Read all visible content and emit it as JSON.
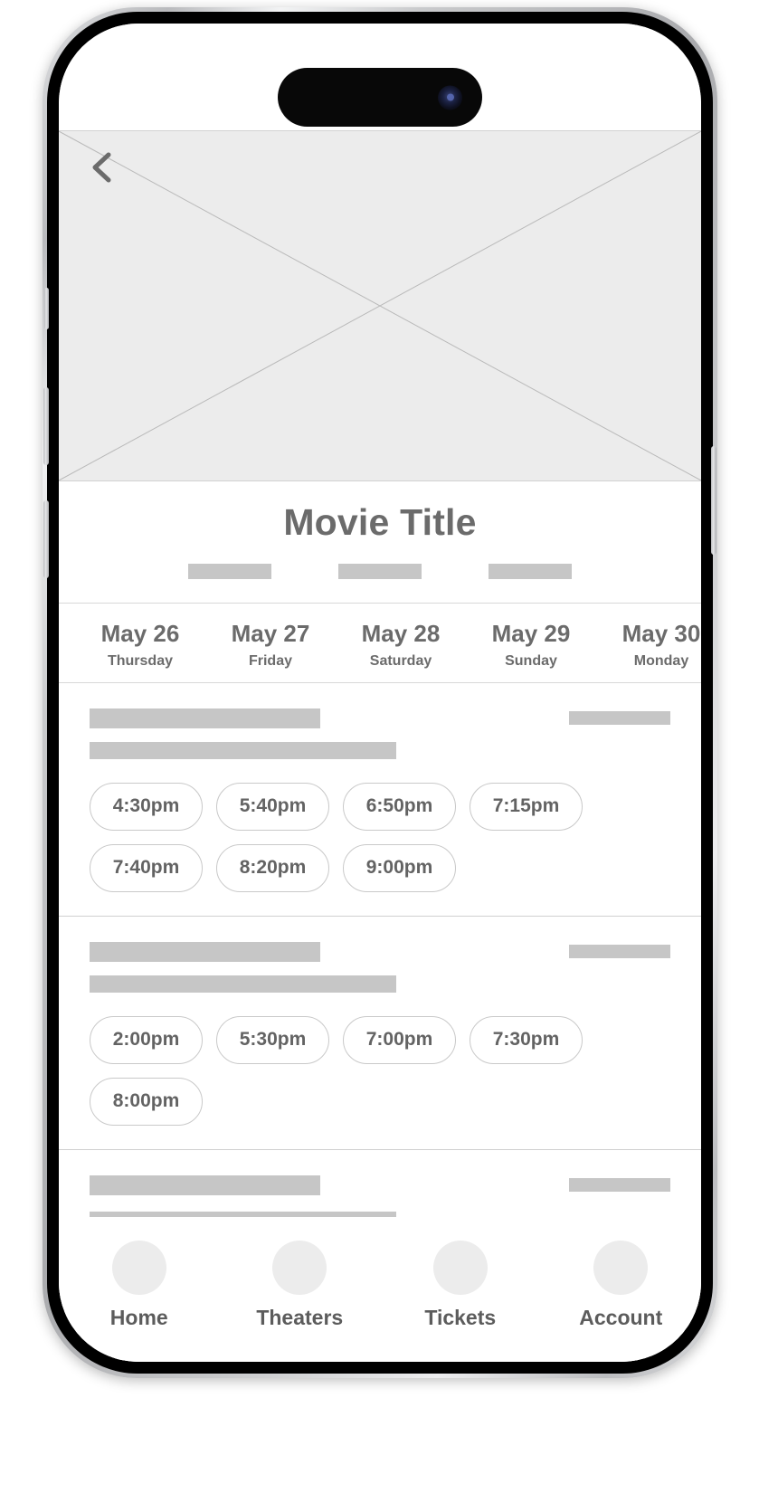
{
  "device": {
    "frame": "iphone-pro",
    "island_label": "dynamic-island",
    "camera_label": "front-camera"
  },
  "screen": {
    "hero": {
      "type": "image-placeholder",
      "back_icon": "chevron-left-icon"
    },
    "title": "Movie Title",
    "meta_placeholders": 3,
    "dates": [
      {
        "day": "May 26",
        "weekday": "Thursday"
      },
      {
        "day": "May 27",
        "weekday": "Friday"
      },
      {
        "day": "May 28",
        "weekday": "Saturday"
      },
      {
        "day": "May 29",
        "weekday": "Sunday"
      },
      {
        "day": "May 30",
        "weekday": "Monday"
      }
    ],
    "theaters": [
      {
        "name_placeholder": true,
        "distance_placeholder": true,
        "address_placeholder": true,
        "showtimes": [
          "4:30pm",
          "5:40pm",
          "6:50pm",
          "7:15pm",
          "7:40pm",
          "8:20pm",
          "9:00pm"
        ]
      },
      {
        "name_placeholder": true,
        "distance_placeholder": true,
        "address_placeholder": true,
        "showtimes": [
          "2:00pm",
          "5:30pm",
          "7:00pm",
          "7:30pm",
          "8:00pm"
        ]
      },
      {
        "name_placeholder": true,
        "distance_placeholder": true,
        "address_placeholder": true,
        "showtimes": []
      }
    ],
    "tabs": [
      {
        "label": "Home",
        "icon": "home-icon"
      },
      {
        "label": "Theaters",
        "icon": "theaters-icon"
      },
      {
        "label": "Tickets",
        "icon": "tickets-icon"
      },
      {
        "label": "Account",
        "icon": "account-icon"
      }
    ]
  },
  "colors": {
    "placeholder_gray": "#c6c6c6",
    "hero_gray": "#ececec",
    "text_gray": "#6b6b6b",
    "pill_border": "#c9c9c9",
    "divider": "#d8d8d8"
  }
}
